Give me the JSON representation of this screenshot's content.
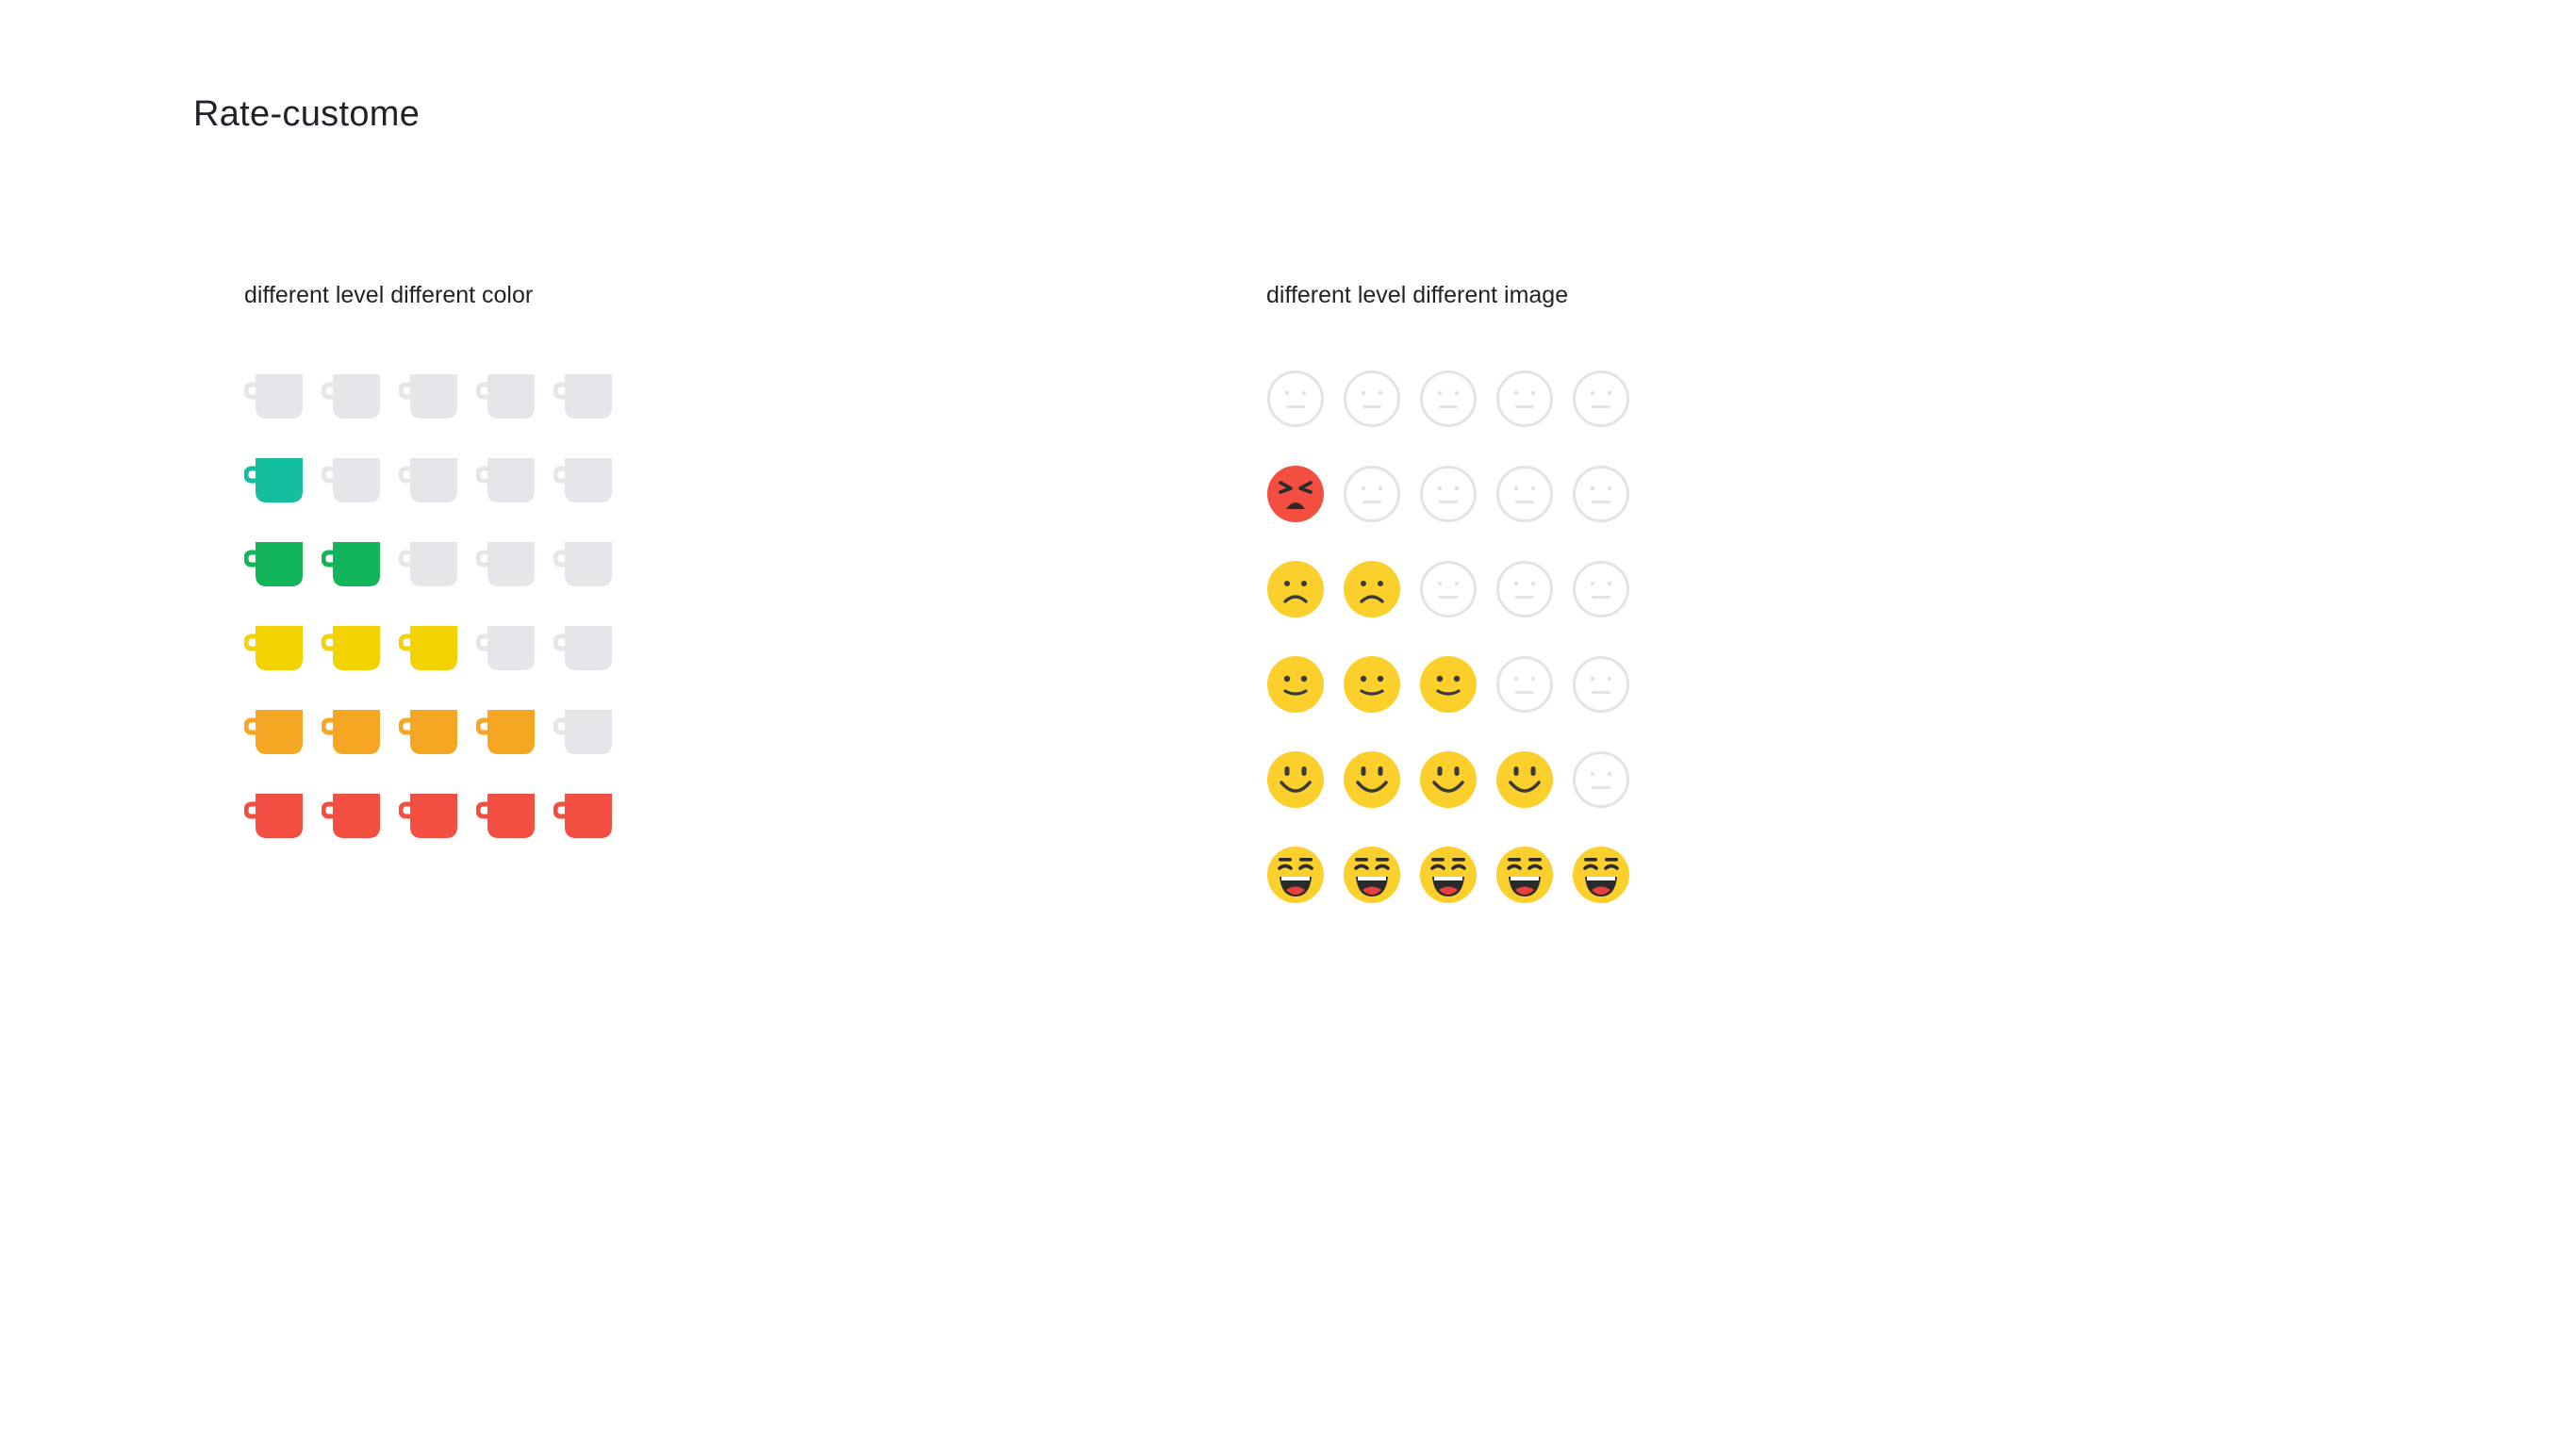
{
  "page": {
    "title": "Rate-custome"
  },
  "colors": {
    "empty": "#e5e6ea",
    "levels": [
      "#13bf9e",
      "#13b55a",
      "#f2d200",
      "#f5a623",
      "#f24e42"
    ],
    "face_empty_stroke": "#e3e3e3",
    "face_yellow": "#fbcf2c",
    "face_angry": "#f24e42"
  },
  "cup_section": {
    "title": "different level different color",
    "max": 5,
    "rows": [
      {
        "value": 0,
        "level": "none"
      },
      {
        "value": 1,
        "level": "1"
      },
      {
        "value": 2,
        "level": "2"
      },
      {
        "value": 3,
        "level": "3"
      },
      {
        "value": 4,
        "level": "4"
      },
      {
        "value": 5,
        "level": "5"
      }
    ]
  },
  "face_section": {
    "title": "different level different image",
    "max": 5,
    "rows": [
      {
        "value": 0,
        "face": "neutral-face-icon"
      },
      {
        "value": 1,
        "face": "angry-face-icon"
      },
      {
        "value": 2,
        "face": "sad-face-icon"
      },
      {
        "value": 3,
        "face": "neutral-face-icon"
      },
      {
        "value": 4,
        "face": "smile-face-icon"
      },
      {
        "value": 5,
        "face": "laugh-face-icon"
      }
    ]
  }
}
